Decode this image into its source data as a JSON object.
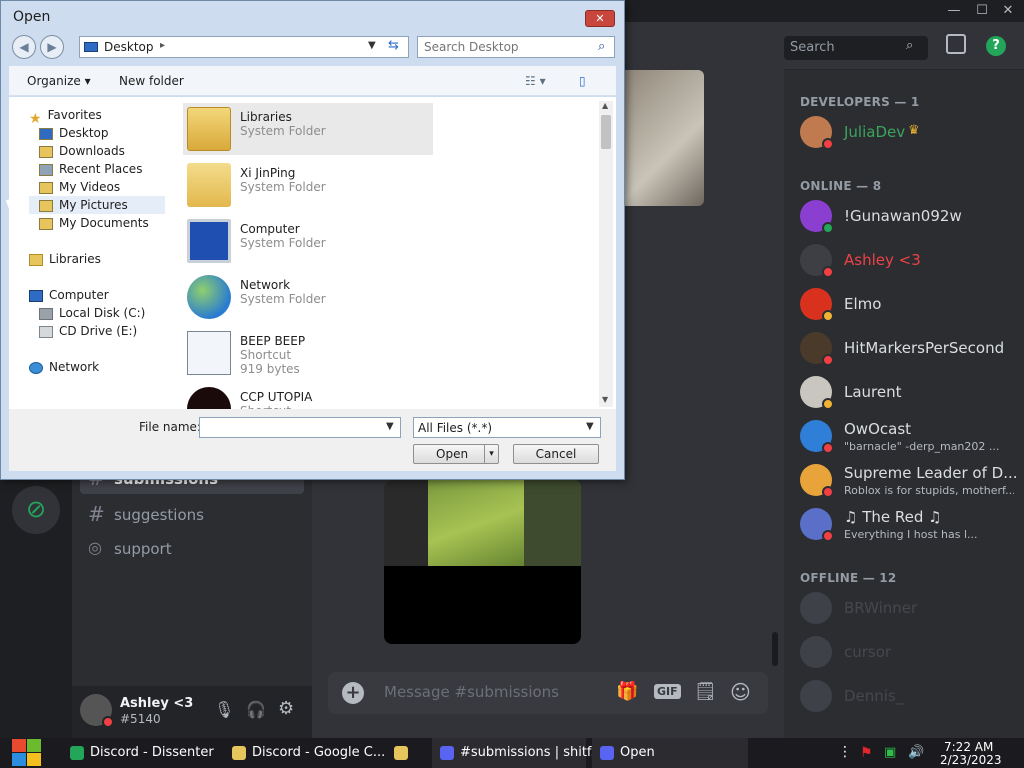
{
  "dialog": {
    "title": "Open",
    "close_label": "✕",
    "address": "Desktop",
    "search_placeholder": "Search Desktop",
    "toolbar": {
      "organize": "Organize ▾",
      "new_folder": "New folder"
    },
    "nav": {
      "favorites": "Favorites",
      "favorite_items": [
        "Desktop",
        "Downloads",
        "Recent Places",
        "My Videos",
        "My Pictures",
        "My Documents"
      ],
      "libraries": "Libraries",
      "computer": "Computer",
      "computer_items": [
        "Local Disk (C:)",
        "CD Drive (E:)"
      ],
      "network": "Network"
    },
    "items": [
      {
        "name": "Libraries",
        "type": "System Folder",
        "extra": ""
      },
      {
        "name": "Xi JinPing",
        "type": "System Folder",
        "extra": ""
      },
      {
        "name": "Computer",
        "type": "System Folder",
        "extra": ""
      },
      {
        "name": "Network",
        "type": "System Folder",
        "extra": ""
      },
      {
        "name": "BEEP BEEP",
        "type": "Shortcut",
        "extra": "919 bytes"
      },
      {
        "name": "CCP UTOPIA",
        "type": "Shortcut",
        "extra": ""
      }
    ],
    "file_name_label": "File name:",
    "file_name_value": "",
    "file_type": "All Files (*.*)",
    "open_label": "Open",
    "cancel_label": "Cancel"
  },
  "discord": {
    "search_placeholder": "Search",
    "channels": [
      "submissions",
      "suggestions",
      "support"
    ],
    "user": {
      "name": "Ashley <3",
      "tag": "#5140"
    },
    "message_placeholder": "Message #submissions",
    "gif_label": "GIF",
    "members": {
      "developers_header": "DEVELOPERS — 1",
      "developers": [
        {
          "name": "JuliaDev",
          "color": "#3ba55d",
          "sub": ""
        }
      ],
      "online_header": "ONLINE — 8",
      "online": [
        {
          "name": "!Gunawan092w",
          "color": "#dbdee1",
          "sub": ""
        },
        {
          "name": "Ashley <3",
          "color": "#ed4245",
          "sub": ""
        },
        {
          "name": "Elmo",
          "color": "#dbdee1",
          "sub": ""
        },
        {
          "name": "HitMarkersPerSecond",
          "color": "#dbdee1",
          "sub": ""
        },
        {
          "name": "Laurent",
          "color": "#dbdee1",
          "sub": ""
        },
        {
          "name": "OwOcast",
          "color": "#dbdee1",
          "sub": "\"barnacle\" -derp_man202 ..."
        },
        {
          "name": "Supreme Leader of D...",
          "color": "#dbdee1",
          "sub": "Roblox is for stupids, motherf..."
        },
        {
          "name": "♫ The Red ♫",
          "color": "#dbdee1",
          "sub": "Everything I host has l..."
        }
      ],
      "offline_header": "OFFLINE — 12",
      "offline": [
        {
          "name": "BRWinner",
          "color": "#6d6f78",
          "sub": ""
        },
        {
          "name": "cursor",
          "color": "#6d6f78",
          "sub": ""
        },
        {
          "name": "Dennis_",
          "color": "#6d6f78",
          "sub": ""
        }
      ]
    }
  },
  "taskbar": {
    "items": [
      "Discord - Dissenter",
      "Discord - Google C...",
      "",
      "#submissions | shitf...",
      "Open"
    ],
    "time": "7:22 AM",
    "date": "2/23/2023"
  }
}
